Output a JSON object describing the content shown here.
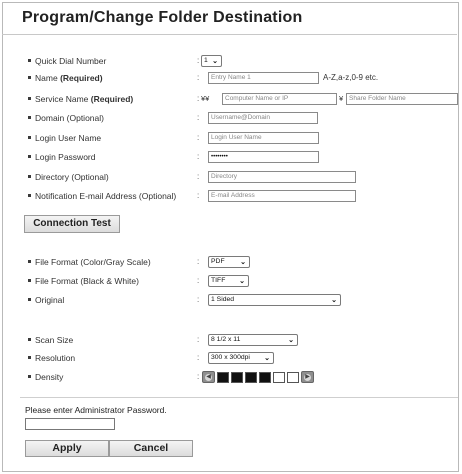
{
  "page": {
    "title": "Program/Change Folder Destination"
  },
  "form": {
    "quick_dial": {
      "label": "Quick Dial Number",
      "value": "1"
    },
    "name": {
      "label": "Name",
      "required": "(Required)",
      "placeholder": "Entry Name 1",
      "hint": "A-Z,a-z,0-9 etc."
    },
    "service_name": {
      "label": "Service Name",
      "required": "(Required)",
      "prefix": "¥¥",
      "computer_placeholder": "Computer Name or IP",
      "separator": "¥",
      "folder_placeholder": "Share Folder Name"
    },
    "domain": {
      "label": "Domain (Optional)",
      "placeholder": "Username@Domain"
    },
    "login_user": {
      "label": "Login User Name",
      "placeholder": "Login User Name"
    },
    "login_password": {
      "label": "Login Password",
      "value": "••••••••"
    },
    "directory": {
      "label": "Directory (Optional)",
      "placeholder": "Directory"
    },
    "notification": {
      "label": "Notification E-mail Address (Optional)",
      "placeholder": "E-mail Address"
    },
    "colon": ":"
  },
  "connection_test": {
    "label": "Connection Test"
  },
  "scan_settings": {
    "file_format_color": {
      "label": "File Format (Color/Gray Scale)",
      "value": "PDF"
    },
    "file_format_bw": {
      "label": "File Format (Black & White)",
      "value": "TIFF"
    },
    "original": {
      "label": "Original",
      "value": "1 Sided"
    },
    "scan_size": {
      "label": "Scan Size",
      "value": "8 1/2 x 11"
    },
    "resolution": {
      "label": "Resolution",
      "value": "300 x 300dpi"
    },
    "density": {
      "label": "Density",
      "level": 4,
      "cells": 6
    }
  },
  "admin": {
    "message": "Please enter Administrator Password.",
    "password": ""
  },
  "buttons": {
    "apply": "Apply",
    "cancel": "Cancel"
  },
  "colors": {
    "accent": "#222222",
    "border": "#8a8a8a",
    "density_dark": "#111111",
    "density_light": "#ffffff"
  }
}
